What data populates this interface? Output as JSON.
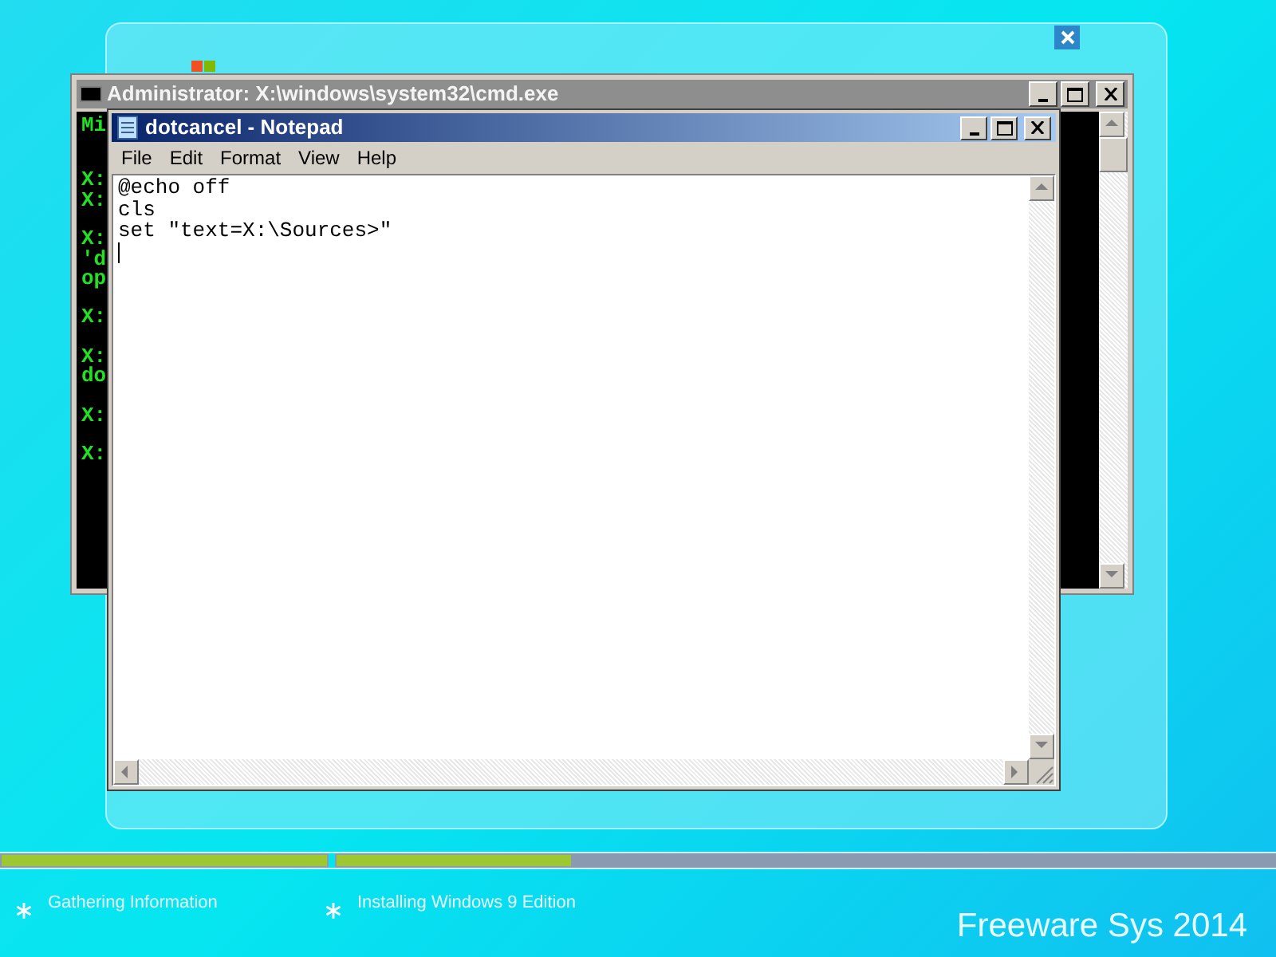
{
  "console_window": {
    "title": "Administrator: X:\\windows\\system32\\cmd.exe",
    "active": false,
    "line_groups": [
      [
        "Mi"
      ],
      [
        "X:",
        "X:"
      ],
      [
        "X:",
        "'d",
        "op"
      ],
      [
        "X:"
      ],
      [
        "X:",
        "do"
      ],
      [
        "X:"
      ],
      [
        "X:"
      ]
    ]
  },
  "notepad": {
    "title": "dotcancel - Notepad",
    "active": true,
    "menu": [
      "File",
      "Edit",
      "Format",
      "View",
      "Help"
    ],
    "lines": [
      "@echo off",
      "cls",
      "set \"text=X:\\Sources>\""
    ]
  },
  "progress": [
    {
      "level": 1
    },
    {
      "level": 0.25
    }
  ],
  "steps": [
    {
      "label": "Gathering Information"
    },
    {
      "label": "Installing Windows 9 Edition"
    }
  ],
  "brand": "Freeware Sys 2014"
}
